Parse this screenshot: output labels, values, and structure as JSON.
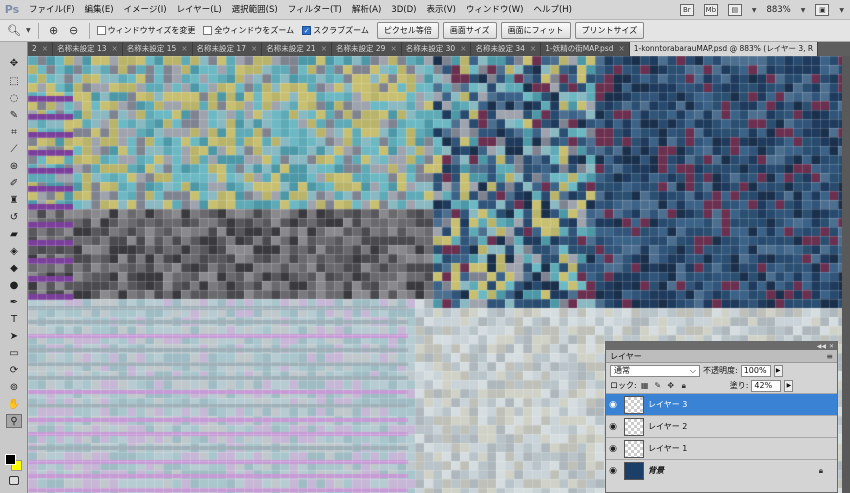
{
  "app": {
    "logo": "Ps"
  },
  "menu": [
    "ファイル(F)",
    "編集(E)",
    "イメージ(I)",
    "レイヤー(L)",
    "選択範囲(S)",
    "フィルター(T)",
    "解析(A)",
    "3D(D)",
    "表示(V)",
    "ウィンドウ(W)",
    "ヘルプ(H)"
  ],
  "menu_right": {
    "br_label": "Br",
    "mb_label": "Mb",
    "zoom": "883%"
  },
  "options": {
    "resize_window": "ウィンドウサイズを変更",
    "zoom_all": "全ウィンドウをズーム",
    "scrubby_zoom": "スクラブズーム",
    "actual_pixels": "ピクセル等倍",
    "fit_screen": "画面サイズ",
    "fill_screen": "画面にフィット",
    "print_size": "プリントサイズ",
    "checkboxes": {
      "resize_window": false,
      "zoom_all": false,
      "scrubby_zoom": true
    }
  },
  "tabs": [
    {
      "label": "2",
      "active": false
    },
    {
      "label": "名称未設定 13",
      "active": false
    },
    {
      "label": "名称未設定 15",
      "active": false
    },
    {
      "label": "名称未設定 17",
      "active": false
    },
    {
      "label": "名称未設定 21",
      "active": false
    },
    {
      "label": "名称未設定 29",
      "active": false
    },
    {
      "label": "名称未設定 30",
      "active": false
    },
    {
      "label": "名称未設定 34",
      "active": false
    },
    {
      "label": "1-妖精の街MAP.psd",
      "active": false
    },
    {
      "label": "1-konntorabarauMAP.psd @ 883% (レイヤー 3, R",
      "active": true
    }
  ],
  "tools": [
    "move",
    "marquee",
    "lasso",
    "quick-select",
    "crop",
    "eyedropper",
    "spot-heal",
    "brush",
    "clone-stamp",
    "history-brush",
    "eraser",
    "paint-bucket",
    "blur",
    "dodge",
    "pen",
    "type",
    "path-select",
    "shape",
    "3d-rotate",
    "3d-orbit",
    "hand",
    "zoom"
  ],
  "selected_tool": "zoom",
  "colors": {
    "foreground": "#000000",
    "background": "#ffff00",
    "selection": "#3a83d4"
  },
  "layers_panel": {
    "title": "レイヤー",
    "blend_mode": "通常",
    "opacity_label": "不透明度:",
    "opacity_value": "100%",
    "lock_label": "ロック:",
    "fill_label": "塗り:",
    "fill_value": "42%",
    "layers": [
      {
        "name": "レイヤー 3",
        "selected": true,
        "locked": false
      },
      {
        "name": "レイヤー 2",
        "selected": false,
        "locked": false
      },
      {
        "name": "レイヤー 1",
        "selected": false,
        "locked": false
      },
      {
        "name": "背景",
        "selected": false,
        "locked": true
      }
    ]
  }
}
